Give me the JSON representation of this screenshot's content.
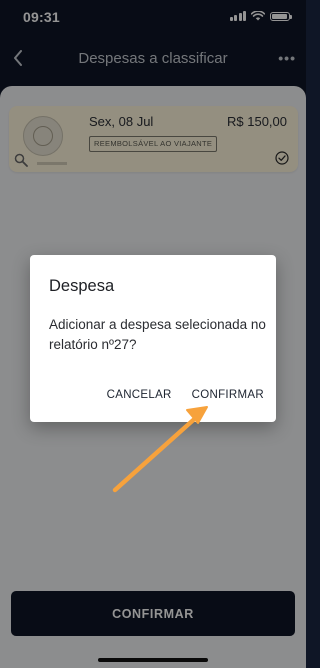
{
  "status_bar": {
    "time": "09:31"
  },
  "nav": {
    "title": "Despesas a classificar",
    "back_icon": "chevron-left-icon",
    "more_icon": "more-horizontal-icon"
  },
  "expense": {
    "date": "Sex, 08 Jul",
    "amount": "R$ 150,00",
    "badge": "REEMBOLSÁVEL AO VIAJANTE",
    "selected": true
  },
  "bottom_button": {
    "label": "CONFIRMAR"
  },
  "dialog": {
    "title": "Despesa",
    "message": "Adicionar a despesa selecionada no relatório nº27?",
    "cancel_label": "CANCELAR",
    "confirm_label": "CONFIRMAR"
  },
  "colors": {
    "accent_arrow": "#f7a23c",
    "dark": "#0f1626",
    "card": "#fff6dc"
  }
}
